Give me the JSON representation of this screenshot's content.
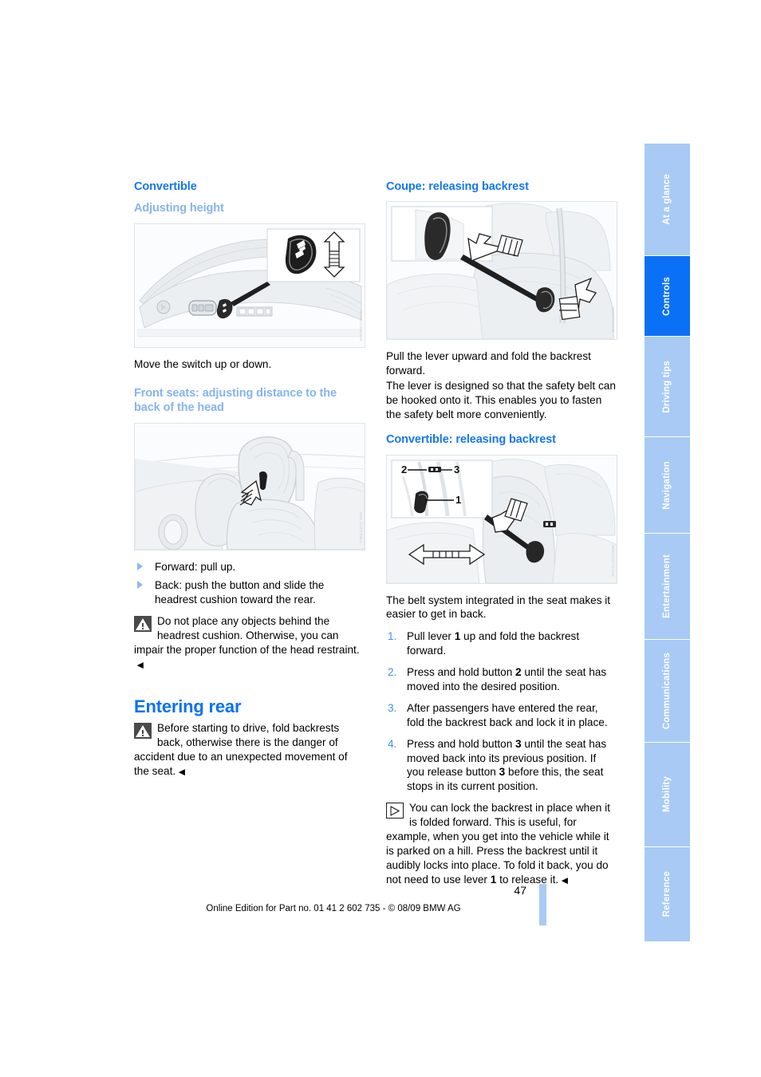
{
  "tabs": [
    {
      "label": "At a glance",
      "active": false
    },
    {
      "label": "Controls",
      "active": true
    },
    {
      "label": "Driving tips",
      "active": false
    },
    {
      "label": "Navigation",
      "active": false
    },
    {
      "label": "Entertainment",
      "active": false
    },
    {
      "label": "Communications",
      "active": false
    },
    {
      "label": "Mobility",
      "active": false
    },
    {
      "label": "Reference",
      "active": false
    }
  ],
  "left": {
    "heading_convertible": "Convertible",
    "sub_adjusting_height": "Adjusting height",
    "fig_seat_switch_code": "WWW/1200/1AW",
    "text_move_switch": "Move the switch up or down.",
    "sub_front_seats": "Front seats: adjusting distance to the back of the head",
    "fig_headrest_code": "WWL/1241/1WAL",
    "bullets": [
      "Forward: pull up.",
      "Back: push the button and slide the headrest cushion toward the rear."
    ],
    "warning_headrest": "Do not place any objects behind the headrest cushion. Otherwise, you can impair the proper function of the head restraint.",
    "heading_entering_rear": "Entering rear",
    "warning_entering_rear": "Before starting to drive, fold backrests back, otherwise there is the danger of accident due to an unexpected movement of the seat."
  },
  "right": {
    "head_coupe": "Coupe: releasing backrest",
    "fig_coupe_code": "WWW/18CAM",
    "coupe_para1": "Pull the lever upward and fold the backrest forward.",
    "coupe_para2": "The lever is designed so that the safety belt can be hooked onto it. This enables you to fasten the safety belt more conveniently.",
    "head_convertible": "Convertible: releasing backrest",
    "fig_convertible_code": "WWCL1271C4AN",
    "fig_callouts": [
      "1",
      "2",
      "3"
    ],
    "convertible_intro": "The belt system integrated in the seat makes it easier to get in back.",
    "steps": [
      {
        "num": "1.",
        "parts": [
          {
            "t": "Pull lever "
          },
          {
            "t": "1",
            "b": true
          },
          {
            "t": " up and fold the backrest forward."
          }
        ]
      },
      {
        "num": "2.",
        "parts": [
          {
            "t": "Press and hold button "
          },
          {
            "t": "2",
            "b": true
          },
          {
            "t": " until the seat has moved into the desired position."
          }
        ]
      },
      {
        "num": "3.",
        "parts": [
          {
            "t": "After passengers have entered the rear, fold the backrest back and lock it in place."
          }
        ]
      },
      {
        "num": "4.",
        "parts": [
          {
            "t": "Press and hold button "
          },
          {
            "t": "3",
            "b": true
          },
          {
            "t": " until the seat has moved back into its previous position. If you release button "
          },
          {
            "t": "3",
            "b": true
          },
          {
            "t": " before this, the seat stops in its current position."
          }
        ]
      }
    ],
    "note_parts": [
      {
        "t": "You can lock the backrest in place when it is folded forward. This is useful, for example, when you get into the vehicle while it is parked on a hill. Press the backrest until it audibly locks into place. To fold it back, you do not need to use lever "
      },
      {
        "t": "1",
        "b": true
      },
      {
        "t": " to release it."
      }
    ]
  },
  "footer": {
    "page_number": "47",
    "edition_line": "Online Edition for Part no. 01 41 2 602 735 - © 08/09 BMW AG"
  },
  "colors": {
    "accent_blue": "#0a71f7",
    "tab_inactive": "#a8caf5",
    "subhead_blue": "#86b4ee",
    "bullet_blue": "#8fb9ee",
    "warn_box": "#4a4a4a"
  }
}
